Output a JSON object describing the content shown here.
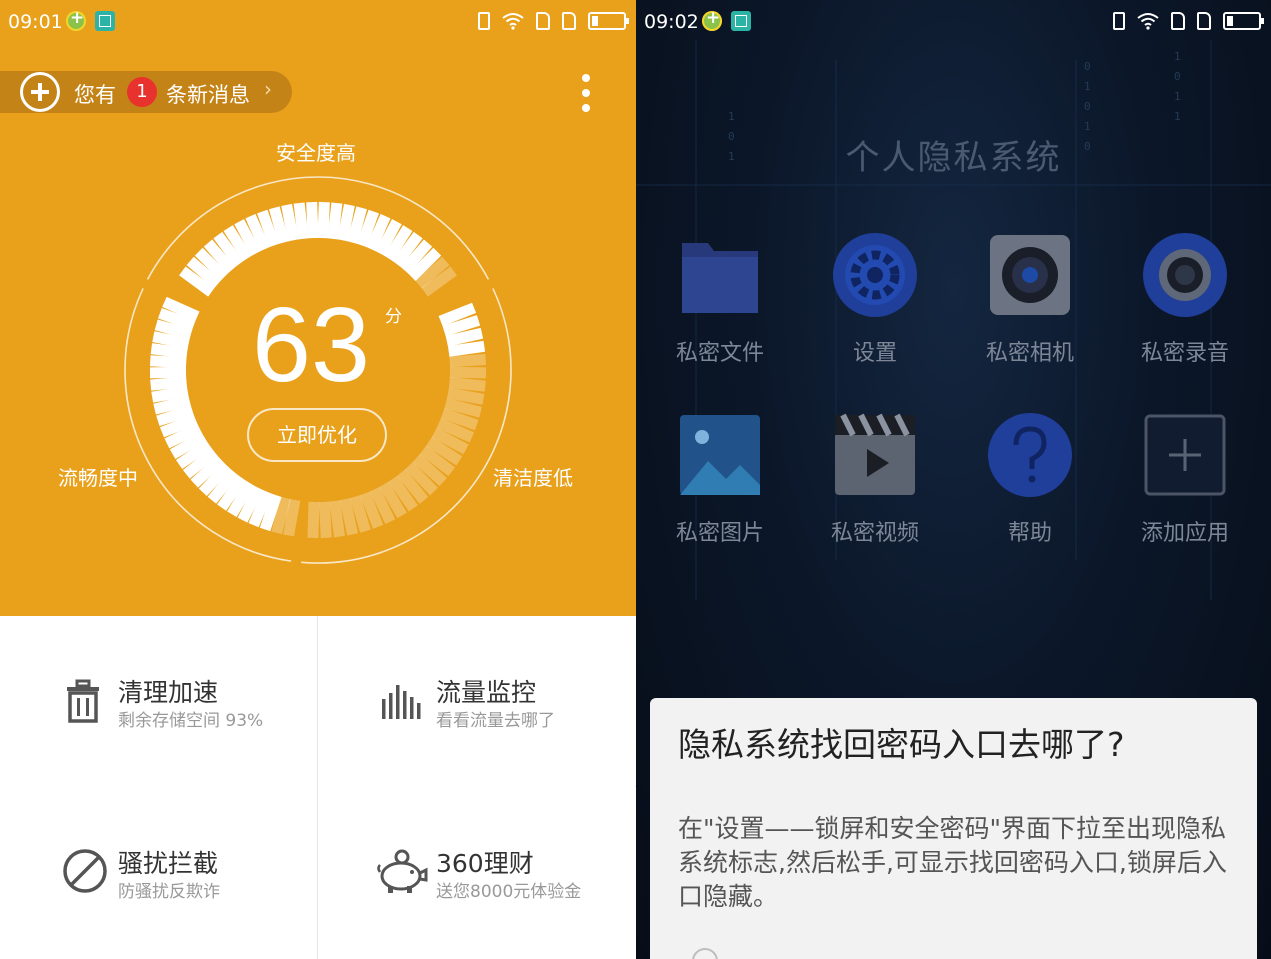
{
  "left": {
    "status": {
      "time": "09:01"
    },
    "message": {
      "prefix": "您有",
      "count": "1",
      "suffix": "条新消息"
    },
    "gauge": {
      "top_label": "安全度高",
      "left_label": "流畅度中",
      "right_label": "清洁度低",
      "score": "63",
      "score_unit": "分",
      "optimize_label": "立即优化"
    },
    "tiles": [
      {
        "title": "清理加速",
        "subtitle": "剩余存储空间 93%",
        "icon": "trash-icon"
      },
      {
        "title": "流量监控",
        "subtitle": "看看流量去哪了",
        "icon": "bar-chart-icon"
      },
      {
        "title": "骚扰拦截",
        "subtitle": "防骚扰反欺诈",
        "icon": "block-icon"
      },
      {
        "title": "360理财",
        "subtitle": "送您8000元体验金",
        "icon": "piggy-bank-icon"
      }
    ],
    "colors": {
      "accent": "#e9a11c",
      "badge": "#e8322d"
    }
  },
  "right": {
    "status": {
      "time": "09:02"
    },
    "title": "个人隐私系统",
    "apps": [
      {
        "label": "私密文件",
        "icon": "folder-icon"
      },
      {
        "label": "设置",
        "icon": "settings-gear-icon"
      },
      {
        "label": "私密相机",
        "icon": "camera-icon"
      },
      {
        "label": "私密录音",
        "icon": "recorder-icon"
      },
      {
        "label": "私密图片",
        "icon": "picture-icon"
      },
      {
        "label": "私密视频",
        "icon": "video-clapper-icon"
      },
      {
        "label": "帮助",
        "icon": "help-icon"
      },
      {
        "label": "添加应用",
        "icon": "add-app-icon"
      }
    ],
    "dialog": {
      "title": "隐私系统找回密码入口去哪了?",
      "body": "在\"设置——锁屏和安全密码\"界面下拉至出现隐私系统标志,然后松手,可显示找回密码入口,锁屏后入口隐藏。"
    }
  }
}
